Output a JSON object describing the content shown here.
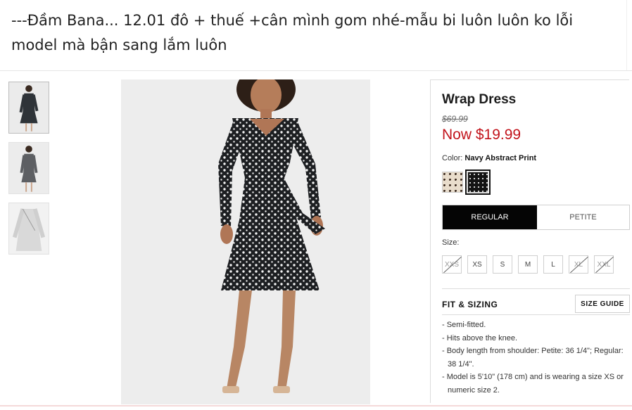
{
  "caption": {
    "text": "---Đầm Bana... 12.01 đô + thuế +cân mình gom nhé-mẫu bi luôn luôn ko lỗi model mà bận sang lắm luôn"
  },
  "product": {
    "title": "Wrap Dress",
    "old_price": "$69.99",
    "now_price": "Now $19.99",
    "color_label": "Color:",
    "color_value": "Navy Abstract Print",
    "fit_tabs": [
      "REGULAR",
      "PETITE"
    ],
    "size_label": "Size:",
    "sizes": [
      {
        "label": "XXS",
        "available": false
      },
      {
        "label": "XS",
        "available": true
      },
      {
        "label": "S",
        "available": true
      },
      {
        "label": "M",
        "available": true
      },
      {
        "label": "L",
        "available": true
      },
      {
        "label": "XL",
        "available": false
      },
      {
        "label": "XXL",
        "available": false
      }
    ],
    "fit_heading": "FIT & SIZING",
    "size_guide": "SIZE GUIDE",
    "specs": [
      "- Semi-fitted.",
      "- Hits above the knee.",
      "- Body length from shoulder: Petite: 36 1/4\"; Regular: 38 1/4\".",
      "- Model is 5'10\" (178 cm) and is wearing a size XS or numeric size 2."
    ]
  },
  "colors": {
    "price_red": "#c2131b",
    "tab_active": "#050505"
  }
}
